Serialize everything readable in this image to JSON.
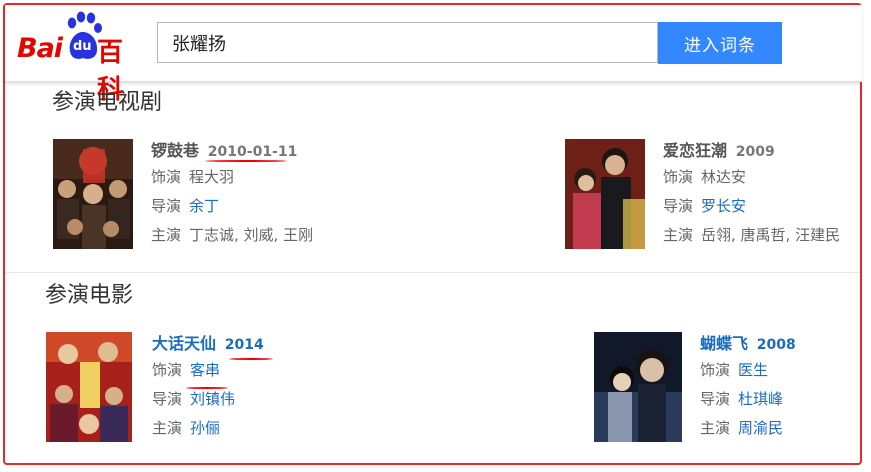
{
  "header": {
    "logo_text_bai": "Bai",
    "logo_text_du": "du",
    "logo_text_baike": "百科",
    "search_value": "张耀扬",
    "search_button_label": "进入词条"
  },
  "tv": {
    "heading": "参演电视剧",
    "items": [
      {
        "title": "锣鼓巷",
        "year": "2010-01-11",
        "role_label": "饰演",
        "role": "程大羽",
        "director_label": "导演",
        "director": "余丁",
        "cast_label": "主演",
        "cast": "丁志诚, 刘威, 王刚"
      },
      {
        "title": "爱恋狂潮",
        "year": "2009",
        "role_label": "饰演",
        "role": "林达安",
        "director_label": "导演",
        "director": "罗长安",
        "cast_label": "主演",
        "cast": "岳翎, 唐禹哲, 汪建民"
      }
    ]
  },
  "film": {
    "heading": "参演电影",
    "items": [
      {
        "title": "大话天仙",
        "year": "2014",
        "role_label": "饰演",
        "role": "客串",
        "director_label": "导演",
        "director": "刘镇伟",
        "cast_label": "主演",
        "cast": "孙俪"
      },
      {
        "title": "蝴蝶飞",
        "year": "2008",
        "role_label": "饰演",
        "role": "医生",
        "director_label": "导演",
        "director": "杜琪峰",
        "cast_label": "主演",
        "cast": "周渝民"
      }
    ]
  },
  "colors": {
    "brand_red": "#e10601",
    "paw_blue": "#2932e1",
    "button_blue": "#3388ff",
    "link_blue": "#1a6cbf",
    "annotation_red": "#e52a2a"
  }
}
